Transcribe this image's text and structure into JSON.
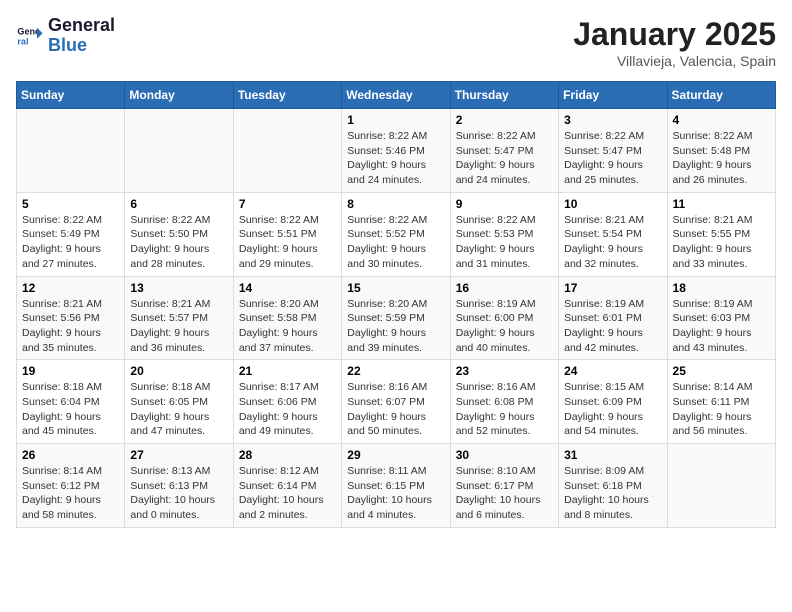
{
  "header": {
    "logo_line1": "General",
    "logo_line2": "Blue",
    "month": "January 2025",
    "location": "Villavieja, Valencia, Spain"
  },
  "weekdays": [
    "Sunday",
    "Monday",
    "Tuesday",
    "Wednesday",
    "Thursday",
    "Friday",
    "Saturday"
  ],
  "weeks": [
    [
      {
        "day": "",
        "info": ""
      },
      {
        "day": "",
        "info": ""
      },
      {
        "day": "",
        "info": ""
      },
      {
        "day": "1",
        "info": "Sunrise: 8:22 AM\nSunset: 5:46 PM\nDaylight: 9 hours\nand 24 minutes."
      },
      {
        "day": "2",
        "info": "Sunrise: 8:22 AM\nSunset: 5:47 PM\nDaylight: 9 hours\nand 24 minutes."
      },
      {
        "day": "3",
        "info": "Sunrise: 8:22 AM\nSunset: 5:47 PM\nDaylight: 9 hours\nand 25 minutes."
      },
      {
        "day": "4",
        "info": "Sunrise: 8:22 AM\nSunset: 5:48 PM\nDaylight: 9 hours\nand 26 minutes."
      }
    ],
    [
      {
        "day": "5",
        "info": "Sunrise: 8:22 AM\nSunset: 5:49 PM\nDaylight: 9 hours\nand 27 minutes."
      },
      {
        "day": "6",
        "info": "Sunrise: 8:22 AM\nSunset: 5:50 PM\nDaylight: 9 hours\nand 28 minutes."
      },
      {
        "day": "7",
        "info": "Sunrise: 8:22 AM\nSunset: 5:51 PM\nDaylight: 9 hours\nand 29 minutes."
      },
      {
        "day": "8",
        "info": "Sunrise: 8:22 AM\nSunset: 5:52 PM\nDaylight: 9 hours\nand 30 minutes."
      },
      {
        "day": "9",
        "info": "Sunrise: 8:22 AM\nSunset: 5:53 PM\nDaylight: 9 hours\nand 31 minutes."
      },
      {
        "day": "10",
        "info": "Sunrise: 8:21 AM\nSunset: 5:54 PM\nDaylight: 9 hours\nand 32 minutes."
      },
      {
        "day": "11",
        "info": "Sunrise: 8:21 AM\nSunset: 5:55 PM\nDaylight: 9 hours\nand 33 minutes."
      }
    ],
    [
      {
        "day": "12",
        "info": "Sunrise: 8:21 AM\nSunset: 5:56 PM\nDaylight: 9 hours\nand 35 minutes."
      },
      {
        "day": "13",
        "info": "Sunrise: 8:21 AM\nSunset: 5:57 PM\nDaylight: 9 hours\nand 36 minutes."
      },
      {
        "day": "14",
        "info": "Sunrise: 8:20 AM\nSunset: 5:58 PM\nDaylight: 9 hours\nand 37 minutes."
      },
      {
        "day": "15",
        "info": "Sunrise: 8:20 AM\nSunset: 5:59 PM\nDaylight: 9 hours\nand 39 minutes."
      },
      {
        "day": "16",
        "info": "Sunrise: 8:19 AM\nSunset: 6:00 PM\nDaylight: 9 hours\nand 40 minutes."
      },
      {
        "day": "17",
        "info": "Sunrise: 8:19 AM\nSunset: 6:01 PM\nDaylight: 9 hours\nand 42 minutes."
      },
      {
        "day": "18",
        "info": "Sunrise: 8:19 AM\nSunset: 6:03 PM\nDaylight: 9 hours\nand 43 minutes."
      }
    ],
    [
      {
        "day": "19",
        "info": "Sunrise: 8:18 AM\nSunset: 6:04 PM\nDaylight: 9 hours\nand 45 minutes."
      },
      {
        "day": "20",
        "info": "Sunrise: 8:18 AM\nSunset: 6:05 PM\nDaylight: 9 hours\nand 47 minutes."
      },
      {
        "day": "21",
        "info": "Sunrise: 8:17 AM\nSunset: 6:06 PM\nDaylight: 9 hours\nand 49 minutes."
      },
      {
        "day": "22",
        "info": "Sunrise: 8:16 AM\nSunset: 6:07 PM\nDaylight: 9 hours\nand 50 minutes."
      },
      {
        "day": "23",
        "info": "Sunrise: 8:16 AM\nSunset: 6:08 PM\nDaylight: 9 hours\nand 52 minutes."
      },
      {
        "day": "24",
        "info": "Sunrise: 8:15 AM\nSunset: 6:09 PM\nDaylight: 9 hours\nand 54 minutes."
      },
      {
        "day": "25",
        "info": "Sunrise: 8:14 AM\nSunset: 6:11 PM\nDaylight: 9 hours\nand 56 minutes."
      }
    ],
    [
      {
        "day": "26",
        "info": "Sunrise: 8:14 AM\nSunset: 6:12 PM\nDaylight: 9 hours\nand 58 minutes."
      },
      {
        "day": "27",
        "info": "Sunrise: 8:13 AM\nSunset: 6:13 PM\nDaylight: 10 hours\nand 0 minutes."
      },
      {
        "day": "28",
        "info": "Sunrise: 8:12 AM\nSunset: 6:14 PM\nDaylight: 10 hours\nand 2 minutes."
      },
      {
        "day": "29",
        "info": "Sunrise: 8:11 AM\nSunset: 6:15 PM\nDaylight: 10 hours\nand 4 minutes."
      },
      {
        "day": "30",
        "info": "Sunrise: 8:10 AM\nSunset: 6:17 PM\nDaylight: 10 hours\nand 6 minutes."
      },
      {
        "day": "31",
        "info": "Sunrise: 8:09 AM\nSunset: 6:18 PM\nDaylight: 10 hours\nand 8 minutes."
      },
      {
        "day": "",
        "info": ""
      }
    ]
  ]
}
